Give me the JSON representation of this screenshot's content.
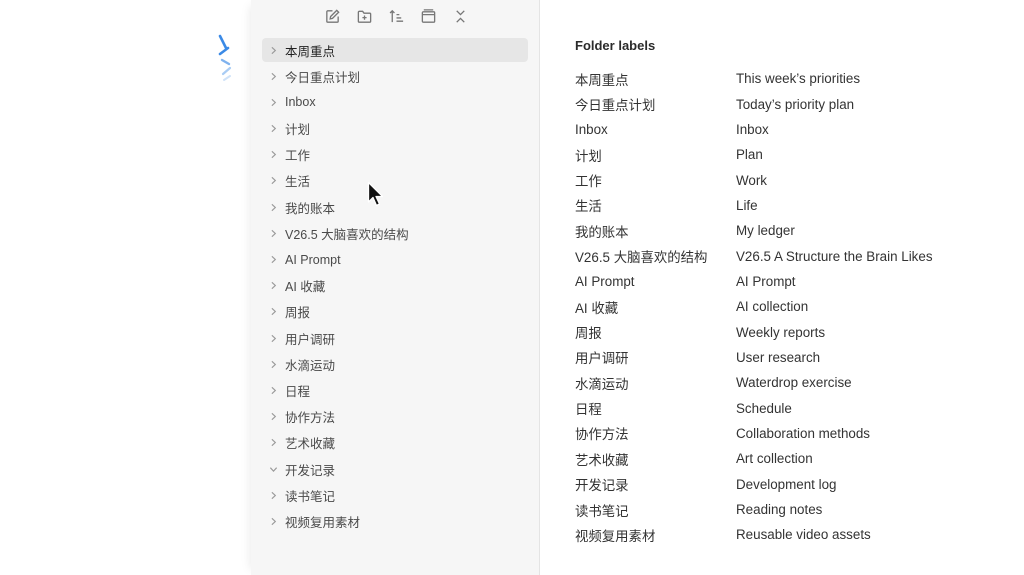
{
  "toolbar": {
    "buttons": [
      {
        "name": "new-note-icon"
      },
      {
        "name": "new-folder-icon"
      },
      {
        "name": "sort-icon"
      },
      {
        "name": "collapse-panel-icon"
      },
      {
        "name": "collapse-all-icon"
      }
    ]
  },
  "sidebar": {
    "items": [
      {
        "label": "本周重点",
        "expanded": false,
        "active": true
      },
      {
        "label": "今日重点计划",
        "expanded": false
      },
      {
        "label": "Inbox",
        "expanded": false
      },
      {
        "label": "计划",
        "expanded": false
      },
      {
        "label": "工作",
        "expanded": false
      },
      {
        "label": "生活",
        "expanded": false
      },
      {
        "label": "我的账本",
        "expanded": false
      },
      {
        "label": "V26.5 大脑喜欢的结构",
        "expanded": false
      },
      {
        "label": "AI Prompt",
        "expanded": false
      },
      {
        "label": "AI 收藏",
        "expanded": false
      },
      {
        "label": "周报",
        "expanded": false
      },
      {
        "label": "用户调研",
        "expanded": false
      },
      {
        "label": "水滴运动",
        "expanded": false
      },
      {
        "label": "日程",
        "expanded": false
      },
      {
        "label": "协作方法",
        "expanded": false
      },
      {
        "label": "艺术收藏",
        "expanded": false
      },
      {
        "label": "开发记录",
        "expanded": true
      },
      {
        "label": "读书笔记",
        "expanded": false
      },
      {
        "label": "视频复用素材",
        "expanded": false
      }
    ]
  },
  "panel": {
    "title": "Folder labels",
    "rows": [
      {
        "zh": "本周重点",
        "en": "This week’s priorities"
      },
      {
        "zh": "今日重点计划",
        "en": "Today’s priority plan"
      },
      {
        "zh": "Inbox",
        "en": "Inbox"
      },
      {
        "zh": "计划",
        "en": "Plan"
      },
      {
        "zh": "工作",
        "en": "Work"
      },
      {
        "zh": "生活",
        "en": "Life"
      },
      {
        "zh": "我的账本",
        "en": "My ledger"
      },
      {
        "zh": "V26.5 大脑喜欢的结构",
        "en": "V26.5 A Structure the Brain Likes"
      },
      {
        "zh": "AI Prompt",
        "en": "AI Prompt"
      },
      {
        "zh": "AI 收藏",
        "en": "AI collection"
      },
      {
        "zh": "周报",
        "en": "Weekly reports"
      },
      {
        "zh": "用户调研",
        "en": "User research"
      },
      {
        "zh": "水滴运动",
        "en": "Waterdrop exercise"
      },
      {
        "zh": "日程",
        "en": "Schedule"
      },
      {
        "zh": "协作方法",
        "en": "Collaboration methods"
      },
      {
        "zh": "艺术收藏",
        "en": "Art collection"
      },
      {
        "zh": "开发记录",
        "en": "Development log"
      },
      {
        "zh": "读书笔记",
        "en": "Reading notes"
      },
      {
        "zh": "视频复用素材",
        "en": "Reusable video assets"
      }
    ]
  },
  "colors": {
    "sidebar_bg": "#f6f6f6",
    "active_row": "#e6e6e6",
    "spinner": "#3b8ae6"
  }
}
